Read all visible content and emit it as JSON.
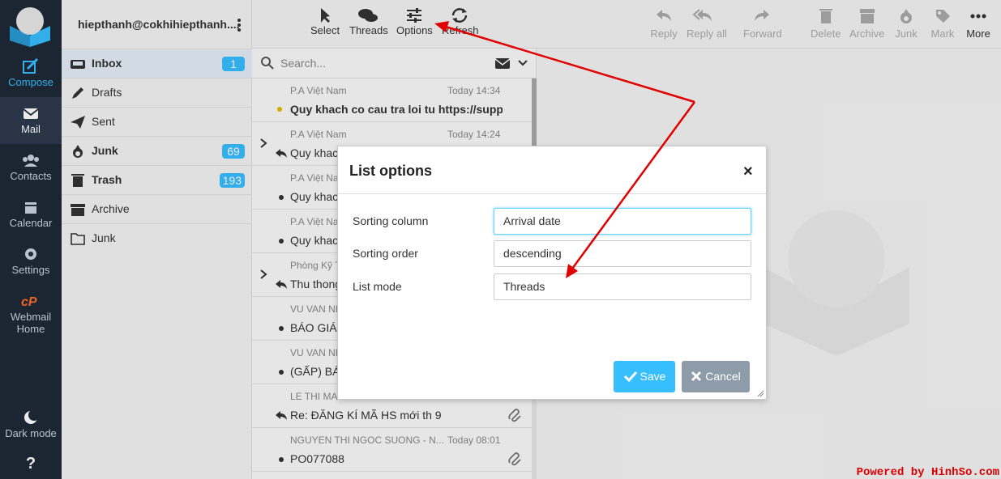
{
  "nav": {
    "items": [
      {
        "label": "Compose",
        "icon": "compose-icon"
      },
      {
        "label": "Mail",
        "icon": "mail-icon"
      },
      {
        "label": "Contacts",
        "icon": "contacts-icon"
      },
      {
        "label": "Calendar",
        "icon": "calendar-icon"
      },
      {
        "label": "Settings",
        "icon": "settings-icon"
      },
      {
        "label": "Webmail",
        "label2": "Home",
        "icon": "cpanel-icon"
      }
    ],
    "dark_mode": "Dark mode",
    "help": "?"
  },
  "account": "hiepthanh@cokhihiepthanh....",
  "folders": [
    {
      "label": "Inbox",
      "count": "1",
      "icon": "inbox-icon"
    },
    {
      "label": "Drafts",
      "count": "",
      "icon": "pencil-icon"
    },
    {
      "label": "Sent",
      "count": "",
      "icon": "paper-plane-icon"
    },
    {
      "label": "Junk",
      "count": "69",
      "icon": "fire-icon"
    },
    {
      "label": "Trash",
      "count": "193",
      "icon": "trash-icon"
    },
    {
      "label": "Archive",
      "count": "",
      "icon": "archive-icon"
    },
    {
      "label": "Junk",
      "count": "",
      "icon": "folder-icon"
    }
  ],
  "list_toolbar": {
    "select": "Select",
    "threads": "Threads",
    "options": "Options",
    "refresh": "Refresh"
  },
  "search": {
    "placeholder": "Search..."
  },
  "messages": [
    {
      "from": "P.A Việt Nam",
      "date": "Today 14:34",
      "subject": "Quy khach co cau tra loi tu https://supp…"
    },
    {
      "from": "P.A Việt Nam",
      "date": "Today 14:24",
      "subject": "Quy khach"
    },
    {
      "from": "P.A Việt Na",
      "date": "",
      "subject": "Quy khac"
    },
    {
      "from": "P.A Việt Na",
      "date": "",
      "subject": "Quy khac"
    },
    {
      "from": "Phòng Kỹ T",
      "date": "",
      "subject": "Thu thong"
    },
    {
      "from": "VU VAN NI",
      "date": "",
      "subject": "BÁO GIÁ"
    },
    {
      "from": "VU VAN NI",
      "date": "",
      "subject": "(GẤP) BÁ"
    },
    {
      "from": "LE THI MA",
      "date": "",
      "subject": "Re: ĐĂNG KÍ MÃ HS mới th 9"
    },
    {
      "from": "NGUYEN THI NGOC SUONG - N...",
      "date": "Today 08:01",
      "subject": "PO077088"
    }
  ],
  "content_toolbar": {
    "reply": "Reply",
    "reply_all": "Reply all",
    "forward": "Forward",
    "delete": "Delete",
    "archive": "Archive",
    "junk": "Junk",
    "mark": "Mark",
    "more": "More"
  },
  "dialog": {
    "title": "List options",
    "close": "×",
    "sorting_column_label": "Sorting column",
    "sorting_column_value": "Arrival date",
    "sorting_order_label": "Sorting order",
    "sorting_order_value": "descending",
    "list_mode_label": "List mode",
    "list_mode_value": "Threads",
    "save": "Save",
    "cancel": "Cancel"
  },
  "watermark": "Powered by HinhSo.com",
  "colors": {
    "accent": "#37beff",
    "nav_bg": "#1f2a38",
    "arrow": "#e00000"
  }
}
